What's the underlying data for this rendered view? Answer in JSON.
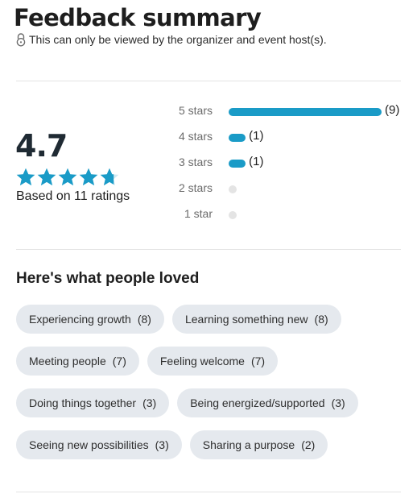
{
  "header": {
    "title": "Feedback summary",
    "privacy_note": "This can only be viewed by the organizer and event host(s)."
  },
  "rating": {
    "average": "4.7",
    "stars_filled": 4.7,
    "stars_total": 5,
    "based_on": "Based on 11 ratings",
    "accent_color": "#1a9bc7"
  },
  "distribution": [
    {
      "label": "5 stars",
      "count": 9,
      "count_label": "(9)"
    },
    {
      "label": "4 stars",
      "count": 1,
      "count_label": "(1)"
    },
    {
      "label": "3 stars",
      "count": 1,
      "count_label": "(1)"
    },
    {
      "label": "2 stars",
      "count": 0,
      "count_label": ""
    },
    {
      "label": "1 star",
      "count": 0,
      "count_label": ""
    }
  ],
  "loved": {
    "title": "Here's what people loved",
    "chip_rows": [
      [
        {
          "label": "Experiencing growth",
          "count": "(8)"
        },
        {
          "label": "Learning something new",
          "count": "(8)"
        }
      ],
      [
        {
          "label": "Meeting people",
          "count": "(7)"
        },
        {
          "label": "Feeling welcome",
          "count": "(7)"
        }
      ],
      [
        {
          "label": "Doing things together",
          "count": "(3)"
        },
        {
          "label": "Being energized/supported",
          "count": "(3)"
        }
      ],
      [
        {
          "label": "Seeing new possibilities",
          "count": "(3)"
        },
        {
          "label": "Sharing a purpose",
          "count": "(2)"
        }
      ]
    ]
  }
}
